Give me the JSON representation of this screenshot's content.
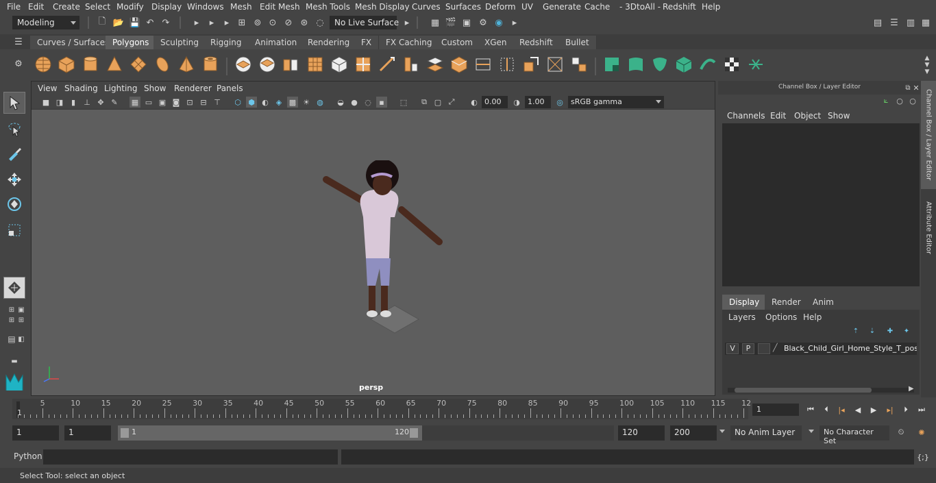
{
  "menubar": {
    "items": [
      "File",
      "Edit",
      "Create",
      "Select",
      "Modify",
      "Display",
      "Windows",
      "Mesh",
      "Edit Mesh",
      "Mesh Tools",
      "Mesh Display",
      "Curves",
      "Surfaces",
      "Deform",
      "UV",
      "Generate",
      "Cache",
      "- 3DtoAll -",
      "Redshift",
      "Help"
    ]
  },
  "statusline": {
    "mode": "Modeling",
    "live_surface": "No Live Surface"
  },
  "shelf": {
    "tabs": [
      "Curves / Surfaces",
      "Polygons",
      "Sculpting",
      "Rigging",
      "Animation",
      "Rendering",
      "FX",
      "FX Caching",
      "Custom",
      "XGen",
      "Redshift",
      "Bullet"
    ],
    "active_tab": "Polygons"
  },
  "viewport": {
    "menu": [
      "View",
      "Shading",
      "Lighting",
      "Show",
      "Renderer",
      "Panels"
    ],
    "exposure": "0.00",
    "gamma": "1.00",
    "colorspace": "sRGB gamma",
    "camera": "persp"
  },
  "channelbox": {
    "title": "Channel Box / Layer Editor",
    "menu": [
      "Channels",
      "Edit",
      "Object",
      "Show"
    ],
    "layer_tabs": [
      "Display",
      "Render",
      "Anim"
    ],
    "active_layer_tab": "Display",
    "layer_menu": [
      "Layers",
      "Options",
      "Help"
    ],
    "layer": {
      "v": "V",
      "p": "P",
      "name": "Black_Child_Girl_Home_Style_T_pose_"
    }
  },
  "side_tabs": [
    "Channel Box / Layer Editor",
    "Attribute Editor"
  ],
  "timeline": {
    "ticks": [
      "5",
      "10",
      "15",
      "20",
      "25",
      "30",
      "35",
      "40",
      "45",
      "50",
      "55",
      "60",
      "65",
      "70",
      "75",
      "80",
      "85",
      "90",
      "95",
      "100",
      "105",
      "110",
      "115",
      "12"
    ],
    "start_label": "1",
    "current_frame": "1"
  },
  "range": {
    "start": "1",
    "start2": "1",
    "range_start": "1",
    "range_end": "120",
    "end": "120",
    "end2": "200",
    "anim_layer": "No Anim Layer",
    "char_set": "No Character Set"
  },
  "cmdline": {
    "label": "Python"
  },
  "helpline": {
    "text": "Select Tool: select an object"
  },
  "colors": {
    "accent_orange": "#e8a25a",
    "accent_teal": "#3bb28a"
  }
}
